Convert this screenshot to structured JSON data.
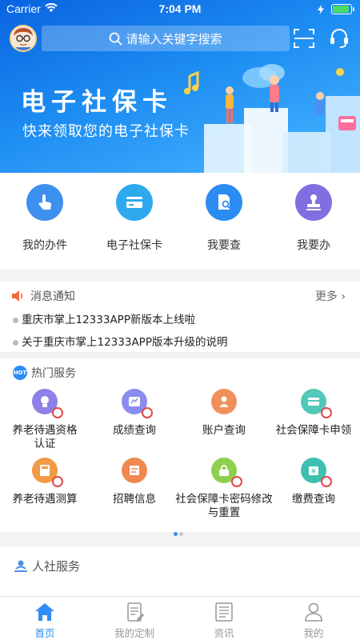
{
  "status": {
    "carrier": "Carrier",
    "time": "7:04 PM"
  },
  "search": {
    "placeholder": "请输入关键字搜索"
  },
  "banner": {
    "title": "电子社保卡",
    "subtitle": "快来领取您的电子社保卡"
  },
  "quick_nav": [
    {
      "label": "我的办件",
      "icon": "hand-tap-icon",
      "color": "#3d8ff0"
    },
    {
      "label": "电子社保卡",
      "icon": "card-icon",
      "color": "#2fa9ee"
    },
    {
      "label": "我要查",
      "icon": "document-search-icon",
      "color": "#2b8cf2"
    },
    {
      "label": "我要办",
      "icon": "stamp-icon",
      "color": "#7f6fe0"
    }
  ],
  "notices": {
    "title": "消息通知",
    "more": "更多 ›",
    "items": [
      "重庆市掌上12333APP新版本上线啦",
      "关于重庆市掌上12333APP版本升级的说明"
    ]
  },
  "hot_services": {
    "badge": "HOT",
    "title": "热门服务",
    "items": [
      {
        "label": "养老待遇资格认证",
        "icon": "pension-cert-icon",
        "color": "#8d80e6"
      },
      {
        "label": "成绩查询",
        "icon": "score-icon",
        "color": "#8b8cf0"
      },
      {
        "label": "账户查询",
        "icon": "account-icon",
        "color": "#f0905a"
      },
      {
        "label": "社会保障卡申领",
        "icon": "card-apply-icon",
        "color": "#52c8b8"
      },
      {
        "label": "养老待遇测算",
        "icon": "calculate-icon",
        "color": "#f29a45"
      },
      {
        "label": "招聘信息",
        "icon": "recruit-icon",
        "color": "#f08850"
      },
      {
        "label": "社会保障卡密码修改与重置",
        "icon": "password-icon",
        "color": "#8fcf4f"
      },
      {
        "label": "缴费查询",
        "icon": "payment-icon",
        "color": "#3fbfb0"
      }
    ]
  },
  "hr_services": {
    "title": "人社服务"
  },
  "tabs": [
    {
      "label": "首页",
      "active": true
    },
    {
      "label": "我的定制",
      "active": false
    },
    {
      "label": "资讯",
      "active": false
    },
    {
      "label": "我的",
      "active": false
    }
  ],
  "colors": {
    "accent": "#2e8ef5",
    "inactive": "#999999",
    "banner_start": "#0a63e0",
    "banner_end": "#49b6ff"
  }
}
